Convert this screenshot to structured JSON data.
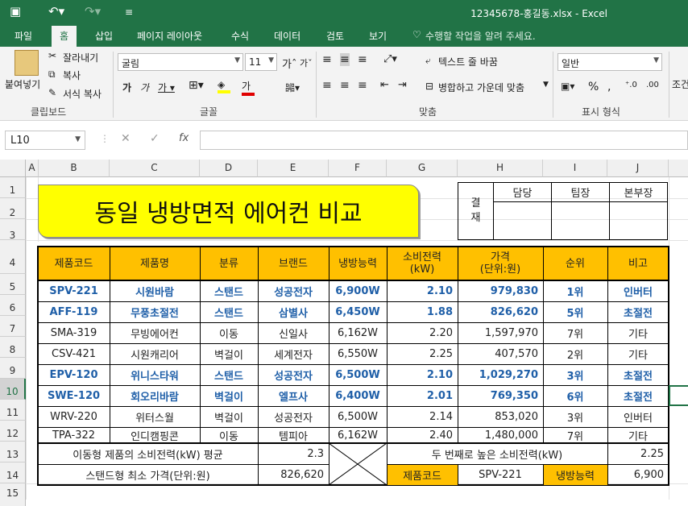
{
  "window": {
    "title": "12345678-홍길동.xlsx - Excel"
  },
  "tabs": [
    "파일",
    "홈",
    "삽입",
    "페이지 레이아웃",
    "수식",
    "데이터",
    "검토",
    "보기"
  ],
  "tell_me": "수행할 작업을 알려 주세요.",
  "ribbon": {
    "paste": "붙여넣기",
    "cut": "잘라내기",
    "copy": "복사",
    "format_painter": "서식 복사",
    "font_name": "굴림",
    "font_size": "11",
    "wrap_text": "텍스트 줄 바꿈",
    "merge_center": "병합하고 가운데 맞춤",
    "number_format": "일반",
    "cond_format": "조건부 서식",
    "groups": {
      "clipboard": "클립보드",
      "font": "글꼴",
      "align": "맞춤",
      "number": "표시 형식"
    }
  },
  "namebox": "L10",
  "columns": [
    "A",
    "B",
    "C",
    "D",
    "E",
    "F",
    "G",
    "H",
    "I",
    "J"
  ],
  "rows": [
    "1",
    "2",
    "3",
    "4",
    "5",
    "6",
    "7",
    "8",
    "9",
    "10",
    "11",
    "12",
    "13",
    "14",
    "15"
  ],
  "sheet": {
    "title": "동일 냉방면적 에어컨 비교",
    "approval": {
      "label_1": "결",
      "label_2": "재",
      "roles": [
        "담당",
        "팀장",
        "본부장"
      ]
    },
    "headers": [
      "제품코드",
      "제품명",
      "분류",
      "브랜드",
      "냉방능력",
      "소비전력\n(kW)",
      "가격\n(단위:원)",
      "순위",
      "비고"
    ],
    "data": [
      [
        "SPV-221",
        "시원바람",
        "스탠드",
        "성공전자",
        "6,900W",
        "2.10",
        "979,830",
        "1위",
        "인버터"
      ],
      [
        "AFF-119",
        "무풍초절전",
        "스탠드",
        "삼별사",
        "6,450W",
        "1.88",
        "826,620",
        "5위",
        "초절전"
      ],
      [
        "SMA-319",
        "무빙에어컨",
        "이동",
        "신일사",
        "6,162W",
        "2.20",
        "1,597,970",
        "7위",
        "기타"
      ],
      [
        "CSV-421",
        "시원캐리어",
        "벽걸이",
        "세계전자",
        "6,550W",
        "2.25",
        "407,570",
        "2위",
        "기타"
      ],
      [
        "EPV-120",
        "위니스타워",
        "스탠드",
        "성공전자",
        "6,500W",
        "2.10",
        "1,029,270",
        "3위",
        "초절전"
      ],
      [
        "SWE-120",
        "회오리바람",
        "벽걸이",
        "엘프사",
        "6,400W",
        "2.01",
        "769,350",
        "6위",
        "초절전"
      ],
      [
        "WRV-220",
        "위터스월",
        "벽걸이",
        "성공전자",
        "6,500W",
        "2.14",
        "853,020",
        "3위",
        "인버터"
      ],
      [
        "TPA-322",
        "인디캠핑콘",
        "이동",
        "템피아",
        "6,162W",
        "2.40",
        "1,480,000",
        "7위",
        "기타"
      ]
    ],
    "highlight_rows": [
      0,
      1,
      4,
      5
    ],
    "summary": {
      "avg_label": "이동형 제품의 소비전력(kW) 평균",
      "avg_value": "2.3",
      "min_label": "스탠드형 최소 가격(단위:원)",
      "min_value": "826,620",
      "second_label": "두 번째로 높은 소비전력(kW)",
      "second_value": "2.25",
      "code_label": "제품코드",
      "code_value": "SPV-221",
      "cap_label": "냉방능력",
      "cap_value": "6,900"
    }
  }
}
